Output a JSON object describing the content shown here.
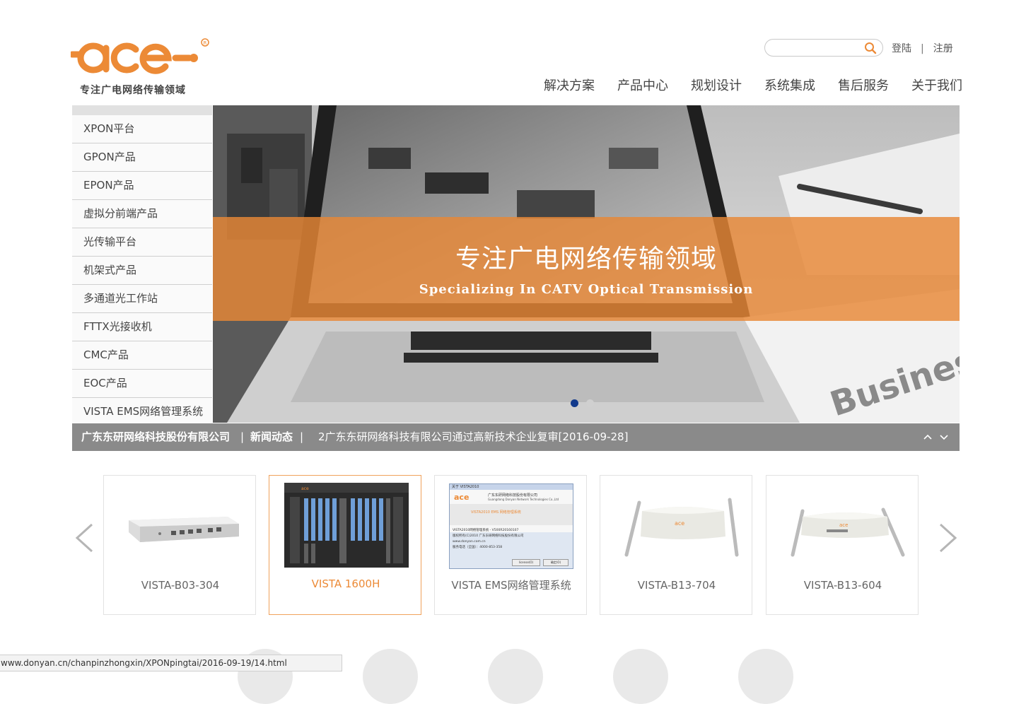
{
  "logo": {
    "brand": "ace",
    "tagline": "专注广电网络传输领域"
  },
  "search": {
    "placeholder": ""
  },
  "auth": {
    "login": "登陆",
    "separator": "|",
    "register": "注册"
  },
  "nav": [
    "解决方案",
    "产品中心",
    "规划设计",
    "系统集成",
    "售后服务",
    "关于我们"
  ],
  "sidebar": [
    "XPON平台",
    "GPON产品",
    "EPON产品",
    "虚拟分前端产品",
    "光传输平台",
    "机架式产品",
    "多通道光工作站",
    "FTTX光接收机",
    "CMC产品",
    "EOC产品",
    "VISTA EMS网络管理系统"
  ],
  "banner": {
    "title": "专注广电网络传输领域",
    "subtitle": "Specializing In CATV Optical Transmission",
    "bg_words": "Business",
    "slides": 2,
    "active_slide": 1
  },
  "news": {
    "company": "广东东研网络科技股份有限公司",
    "separator": "|",
    "section": "新闻动态",
    "headline": "2广东东研网络科技有限公司通过高新技术企业复审[2016-09-28]"
  },
  "products": [
    {
      "label": "VISTA-B03-304",
      "image": "gateway-device",
      "active": false
    },
    {
      "label": "VISTA 1600H",
      "image": "rack-chassis",
      "active": true
    },
    {
      "label": "VISTA EMS网络管理系统",
      "image": "software-dialog",
      "active": false
    },
    {
      "label": "VISTA-B13-704",
      "image": "router-antennas",
      "active": false
    },
    {
      "label": "VISTA-B13-604",
      "image": "router-antennas",
      "active": false
    }
  ],
  "ems_dialog": {
    "title": "关于 VISTA2010",
    "company_cn": "广东东研网络科技股份有限公司",
    "company_en": "Guangdong Donyan Network Technologies Co.,Ltd",
    "product": "VISTA2010 EMS 网络管理系统",
    "version": "VISTA2010网络管理系统 - V500R20160107",
    "copyright": "版权所有(C)2010 广东东研网络科技股份有限公司",
    "site": "www.donyan.com.cn",
    "phone": "服务电话（全国）：4000-853-358",
    "btn1": "license(O)",
    "btn2": "确定(O)"
  },
  "status_url": "www.donyan.cn/chanpinzhongxin/XPONpingtai/2016-09-19/14.html",
  "colors": {
    "brand": "#ec8a36",
    "newsbar": "#8a8a8a",
    "nav_text": "#444444"
  }
}
